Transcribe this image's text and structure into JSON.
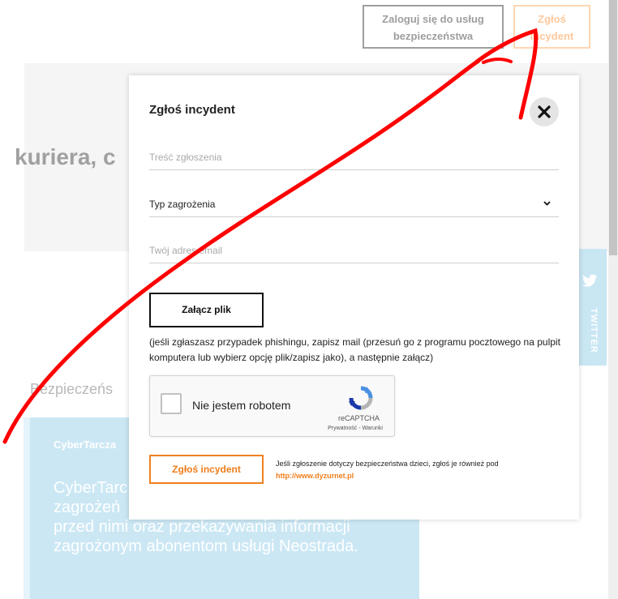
{
  "header": {
    "login_line1": "Zaloguj się do usług",
    "login_line2": "bezpieczeństwa",
    "report_line1": "Zgłoś",
    "report_line2": "incydent"
  },
  "background": {
    "heading": "kuriera, c",
    "twitter_label": "TWITTER",
    "section_title": "Bezpieczeńs",
    "card_title": "CyberTarcza",
    "card_text_line1": "CyberTarc",
    "card_text_line2": "zagrożeń",
    "card_text_line3": "przed nimi oraz przekazywania informacji",
    "card_text_line4": "zagrożonym abonentom usługi Neostrada."
  },
  "modal": {
    "title": "Zgłoś incydent",
    "message_placeholder": "Treść zgłoszenia",
    "threat_type_value": "Typ zagrożenia",
    "email_placeholder": "Twój adres email",
    "attach_label": "Załącz plik",
    "attach_note": "(jeśli zgłaszasz przypadek phishingu, zapisz mail (przesuń go z programu pocztowego na pulpit komputera lub wybierz opcję plik/zapisz jako), a następnie załącz)",
    "captcha_label": "Nie jestem robotem",
    "captcha_brand": "reCAPTCHA",
    "captcha_terms": "Prywatność - Warunki",
    "submit_label": "Zgłoś incydent",
    "child_note": "Jeśli zgłoszenie dotyczy bezpieczeństwa dzieci, zgłoś je również pod",
    "child_link": "http://www.dyzurnet.pl"
  },
  "colors": {
    "accent": "#ef7d1b",
    "scribble": "#ff0000",
    "twitter_bg": "#c9e6f3"
  }
}
